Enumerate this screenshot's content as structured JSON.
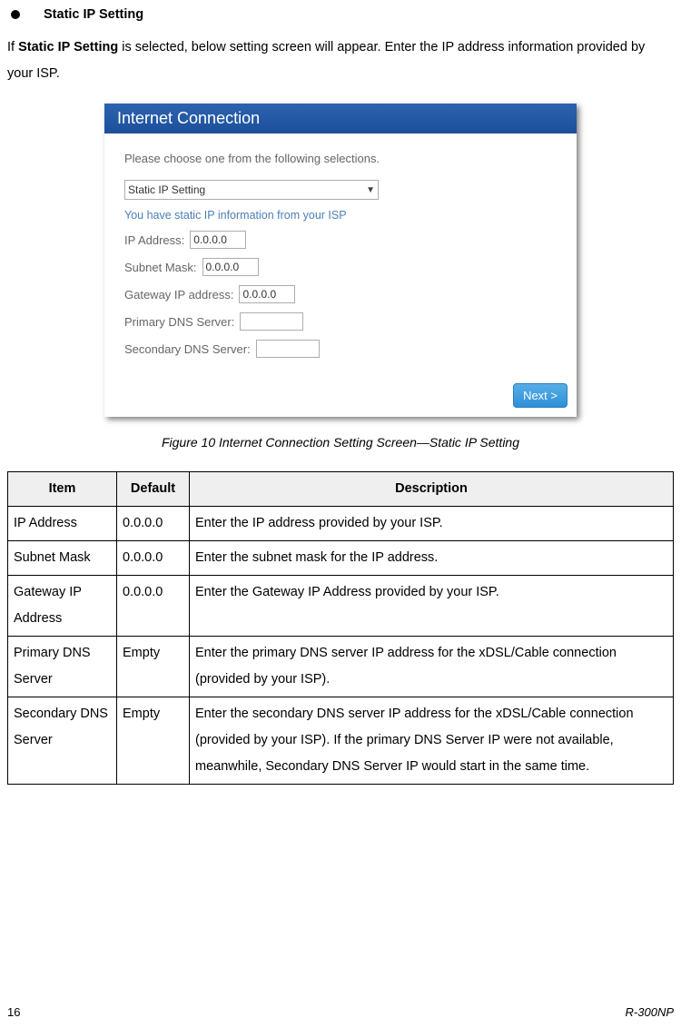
{
  "heading": "Static IP Setting",
  "intro_prefix": "If ",
  "intro_bold": "Static IP Setting",
  "intro_suffix": " is selected, below setting screen will appear. Enter the IP address information provided by your ISP.",
  "screenshot": {
    "titlebar": "Internet Connection",
    "prompt": "Please choose one from the following selections.",
    "select_value": "Static IP Setting",
    "hint": "You have static IP information from your ISP",
    "rows": {
      "ip_label": "IP Address:",
      "ip_value": "0.0.0.0",
      "mask_label": "Subnet Mask:",
      "mask_value": "0.0.0.0",
      "gw_label": "Gateway IP address:",
      "gw_value": "0.0.0.0",
      "pdns_label": "Primary DNS Server:",
      "pdns_value": "",
      "sdns_label": "Secondary DNS Server:",
      "sdns_value": ""
    },
    "next": "Next >"
  },
  "caption": "Figure 10 Internet Connection Setting Screen—Static IP Setting",
  "table": {
    "headers": {
      "item": "Item",
      "default": "Default",
      "desc": "Description"
    },
    "rows": [
      {
        "item": "IP Address",
        "default": "0.0.0.0",
        "desc": "Enter the IP address provided by your ISP."
      },
      {
        "item": "Subnet Mask",
        "default": "0.0.0.0",
        "desc": "Enter the subnet mask for the IP address."
      },
      {
        "item": "Gateway IP Address",
        "default": "0.0.0.0",
        "desc": "Enter the Gateway IP Address provided by your ISP."
      },
      {
        "item": "Primary DNS Server",
        "default": "Empty",
        "desc": "Enter the primary DNS server IP address for the xDSL/Cable connection (provided by your ISP)."
      },
      {
        "item": "Secondary DNS Server",
        "default": "Empty",
        "desc": "Enter the secondary DNS server IP address for the xDSL/Cable connection (provided by your ISP). If the primary DNS Server IP were not available, meanwhile, Secondary DNS Server IP would start in the same time."
      }
    ]
  },
  "footer": {
    "page": "16",
    "model": "R-300NP"
  }
}
